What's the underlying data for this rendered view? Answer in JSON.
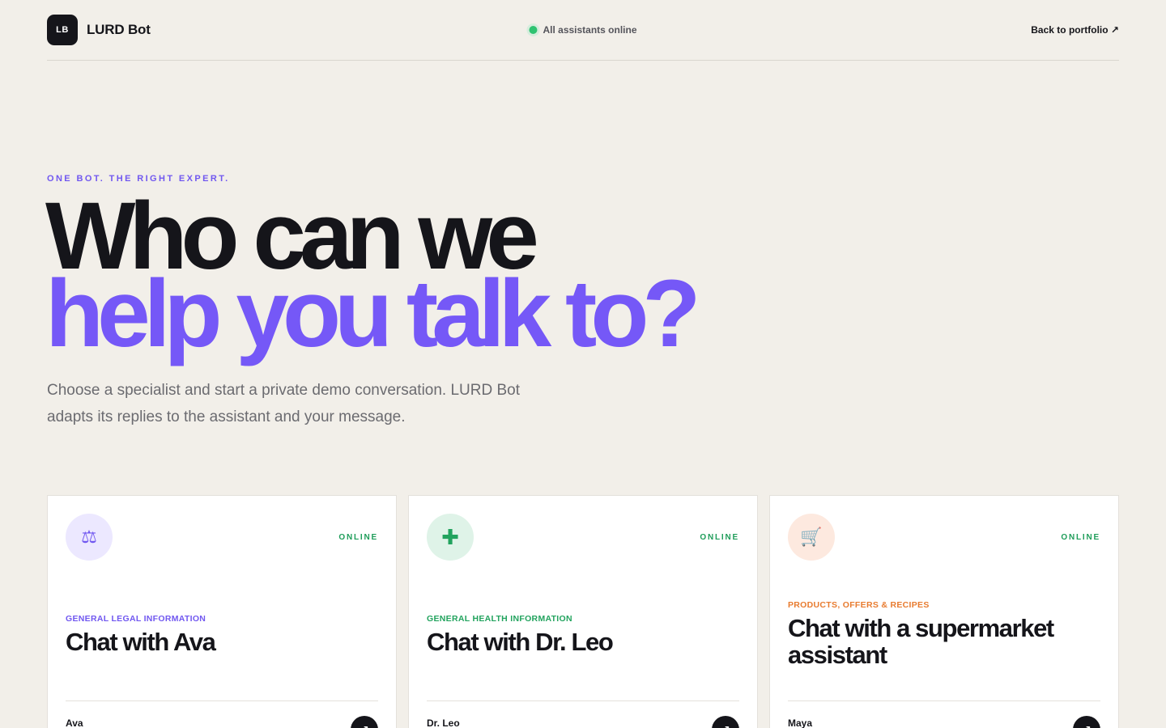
{
  "header": {
    "logo_initials": "LB",
    "brand": "LURD Bot",
    "status": "All assistants online",
    "back_link": "Back to portfolio ↗"
  },
  "hero": {
    "eyebrow": "ONE BOT. THE RIGHT EXPERT.",
    "headline_line1": "Who can we",
    "headline_line2": "help you talk to?",
    "lead": "Choose a specialist and start a private demo conversation. LURD Bot adapts its replies to the assistant and your message."
  },
  "cards": [
    {
      "icon": "scales-icon",
      "icon_glyph": "⚖",
      "status": "ONLINE",
      "category": "GENERAL LEGAL INFORMATION",
      "title": "Chat with Ava",
      "agent": "Ava",
      "button_glyph": "↗"
    },
    {
      "icon": "medical-cross-icon",
      "icon_glyph": "✚",
      "status": "ONLINE",
      "category": "GENERAL HEALTH INFORMATION",
      "title": "Chat with Dr. Leo",
      "agent": "Dr. Leo",
      "button_glyph": "↗"
    },
    {
      "icon": "shopping-cart-icon",
      "icon_glyph": "🛒",
      "status": "ONLINE",
      "category": "PRODUCTS, OFFERS & RECIPES",
      "title": "Chat with a supermarket assistant",
      "agent": "Maya",
      "button_glyph": "↗"
    }
  ],
  "colors": {
    "background": "#f2efe9",
    "accent_purple": "#7558f7",
    "online_green": "#1f9d5a",
    "status_dot": "#2fc371",
    "legal_bg": "#ece8ff",
    "legal_fg": "#7158f0",
    "health_bg": "#dff3e8",
    "health_fg": "#22a35e",
    "shop_bg": "#fde9df",
    "shop_fg": "#e87b2f"
  }
}
